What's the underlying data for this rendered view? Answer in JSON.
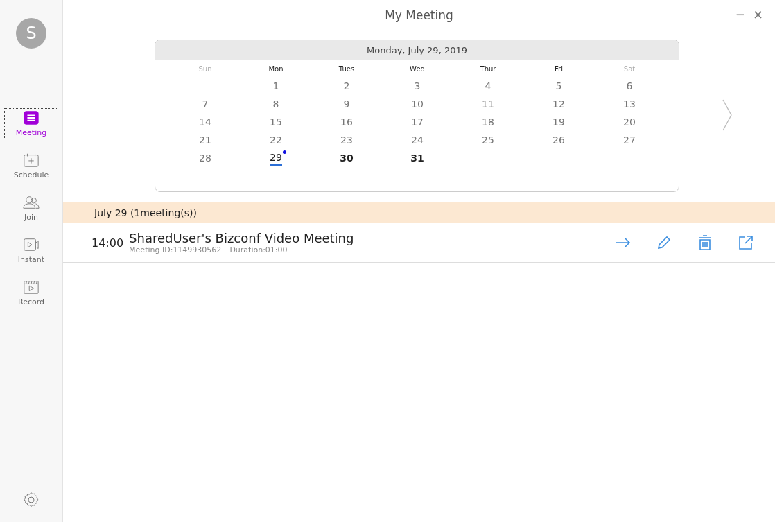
{
  "window": {
    "title": "My Meeting",
    "minimize": "−",
    "close": "×"
  },
  "user": {
    "initial": "S"
  },
  "sidebar": {
    "items": [
      {
        "kind": "meeting",
        "label": "Meeting",
        "selected": true
      },
      {
        "kind": "schedule",
        "label": "Schedule",
        "selected": false
      },
      {
        "kind": "join",
        "label": "Join",
        "selected": false
      },
      {
        "kind": "instant",
        "label": "Instant",
        "selected": false
      },
      {
        "kind": "record",
        "label": "Record",
        "selected": false
      }
    ]
  },
  "calendar": {
    "title": "Monday, July 29, 2019",
    "weekdays": [
      {
        "label": "Sun",
        "weekend": true
      },
      {
        "label": "Mon",
        "weekend": false
      },
      {
        "label": "Tues",
        "weekend": false
      },
      {
        "label": "Wed",
        "weekend": false
      },
      {
        "label": "Thur",
        "weekend": false
      },
      {
        "label": "Fri",
        "weekend": false
      },
      {
        "label": "Sat",
        "weekend": true
      }
    ],
    "weeks": [
      [
        {
          "label": "1",
          "upcoming": false,
          "selected": false,
          "has_meeting": false
        },
        {
          "label": "2",
          "upcoming": false,
          "selected": false,
          "has_meeting": false
        },
        {
          "label": "3",
          "upcoming": false,
          "selected": false,
          "has_meeting": false
        },
        {
          "label": "4",
          "upcoming": false,
          "selected": false,
          "has_meeting": false
        },
        {
          "label": "5",
          "upcoming": false,
          "selected": false,
          "has_meeting": false
        },
        {
          "label": "6",
          "upcoming": false,
          "selected": false,
          "has_meeting": false
        }
      ],
      [
        {
          "label": "7",
          "upcoming": false,
          "selected": false,
          "has_meeting": false
        },
        {
          "label": "8",
          "upcoming": false,
          "selected": false,
          "has_meeting": false
        },
        {
          "label": "9",
          "upcoming": false,
          "selected": false,
          "has_meeting": false
        },
        {
          "label": "10",
          "upcoming": false,
          "selected": false,
          "has_meeting": false
        },
        {
          "label": "11",
          "upcoming": false,
          "selected": false,
          "has_meeting": false
        },
        {
          "label": "12",
          "upcoming": false,
          "selected": false,
          "has_meeting": false
        },
        {
          "label": "13",
          "upcoming": false,
          "selected": false,
          "has_meeting": false
        }
      ],
      [
        {
          "label": "14",
          "upcoming": false,
          "selected": false,
          "has_meeting": false
        },
        {
          "label": "15",
          "upcoming": false,
          "selected": false,
          "has_meeting": false
        },
        {
          "label": "16",
          "upcoming": false,
          "selected": false,
          "has_meeting": false
        },
        {
          "label": "17",
          "upcoming": false,
          "selected": false,
          "has_meeting": false
        },
        {
          "label": "18",
          "upcoming": false,
          "selected": false,
          "has_meeting": false
        },
        {
          "label": "19",
          "upcoming": false,
          "selected": false,
          "has_meeting": false
        },
        {
          "label": "20",
          "upcoming": false,
          "selected": false,
          "has_meeting": false
        }
      ],
      [
        {
          "label": "21",
          "upcoming": false,
          "selected": false,
          "has_meeting": false
        },
        {
          "label": "22",
          "upcoming": false,
          "selected": false,
          "has_meeting": false
        },
        {
          "label": "23",
          "upcoming": false,
          "selected": false,
          "has_meeting": false
        },
        {
          "label": "24",
          "upcoming": false,
          "selected": false,
          "has_meeting": false
        },
        {
          "label": "25",
          "upcoming": false,
          "selected": false,
          "has_meeting": false
        },
        {
          "label": "26",
          "upcoming": false,
          "selected": false,
          "has_meeting": false
        },
        {
          "label": "27",
          "upcoming": false,
          "selected": false,
          "has_meeting": false
        }
      ],
      [
        {
          "label": "28",
          "upcoming": false,
          "selected": false,
          "has_meeting": false
        },
        {
          "label": "29",
          "upcoming": true,
          "selected": true,
          "has_meeting": true
        },
        {
          "label": "30",
          "upcoming": true,
          "selected": false,
          "has_meeting": false
        },
        {
          "label": "31",
          "upcoming": true,
          "selected": false,
          "has_meeting": false
        }
      ]
    ]
  },
  "day_header": "July 29 (1meeting(s))",
  "meetings": [
    {
      "time": "14:00",
      "title": "SharedUser's Bizconf Video Meeting",
      "meeting_id": "Meeting ID:1149930562",
      "duration": "Duration:01:00"
    }
  ]
}
